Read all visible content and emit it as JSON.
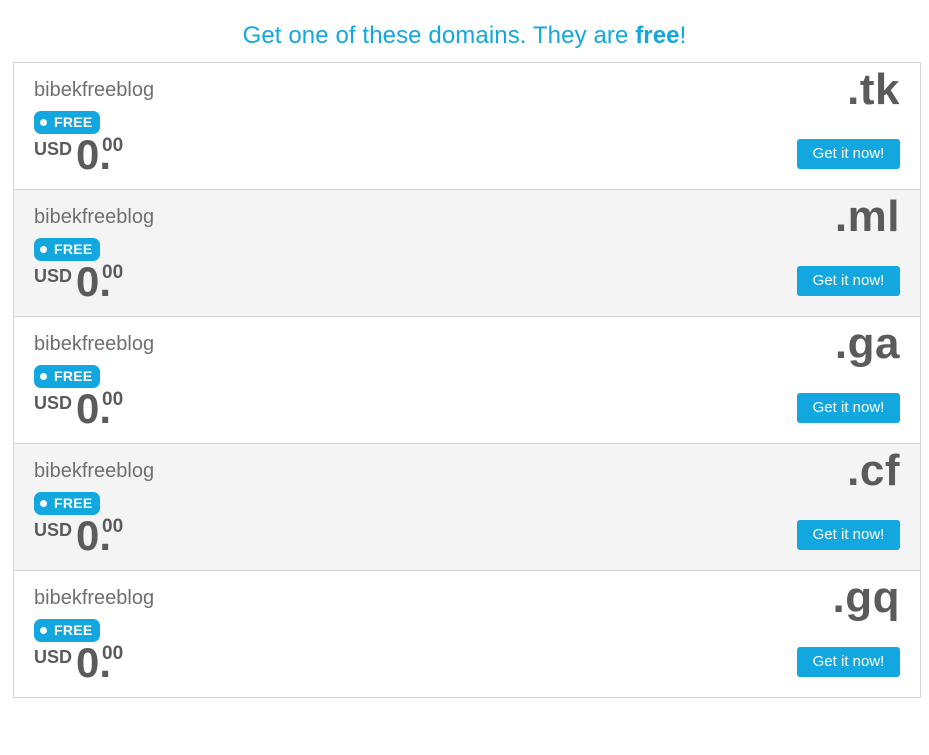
{
  "heading": {
    "prefix": "Get one of these domains. They are ",
    "emphasis": "free",
    "suffix": "!"
  },
  "domains": [
    {
      "name": "bibekfreeblog",
      "tld": ".tk",
      "badge": "FREE",
      "currency": "USD",
      "price_whole": "0.",
      "price_cents": "00",
      "button": "Get it now!"
    },
    {
      "name": "bibekfreeblog",
      "tld": ".ml",
      "badge": "FREE",
      "currency": "USD",
      "price_whole": "0.",
      "price_cents": "00",
      "button": "Get it now!"
    },
    {
      "name": "bibekfreeblog",
      "tld": ".ga",
      "badge": "FREE",
      "currency": "USD",
      "price_whole": "0.",
      "price_cents": "00",
      "button": "Get it now!"
    },
    {
      "name": "bibekfreeblog",
      "tld": ".cf",
      "badge": "FREE",
      "currency": "USD",
      "price_whole": "0.",
      "price_cents": "00",
      "button": "Get it now!"
    },
    {
      "name": "bibekfreeblog",
      "tld": ".gq",
      "badge": "FREE",
      "currency": "USD",
      "price_whole": "0.",
      "price_cents": "00",
      "button": "Get it now!"
    }
  ],
  "colors": {
    "accent": "#13a7e0",
    "text": "#5b5b5b",
    "name_text": "#6f6f6f",
    "alt_row": "#f4f4f4",
    "border": "#d6d6d6"
  }
}
